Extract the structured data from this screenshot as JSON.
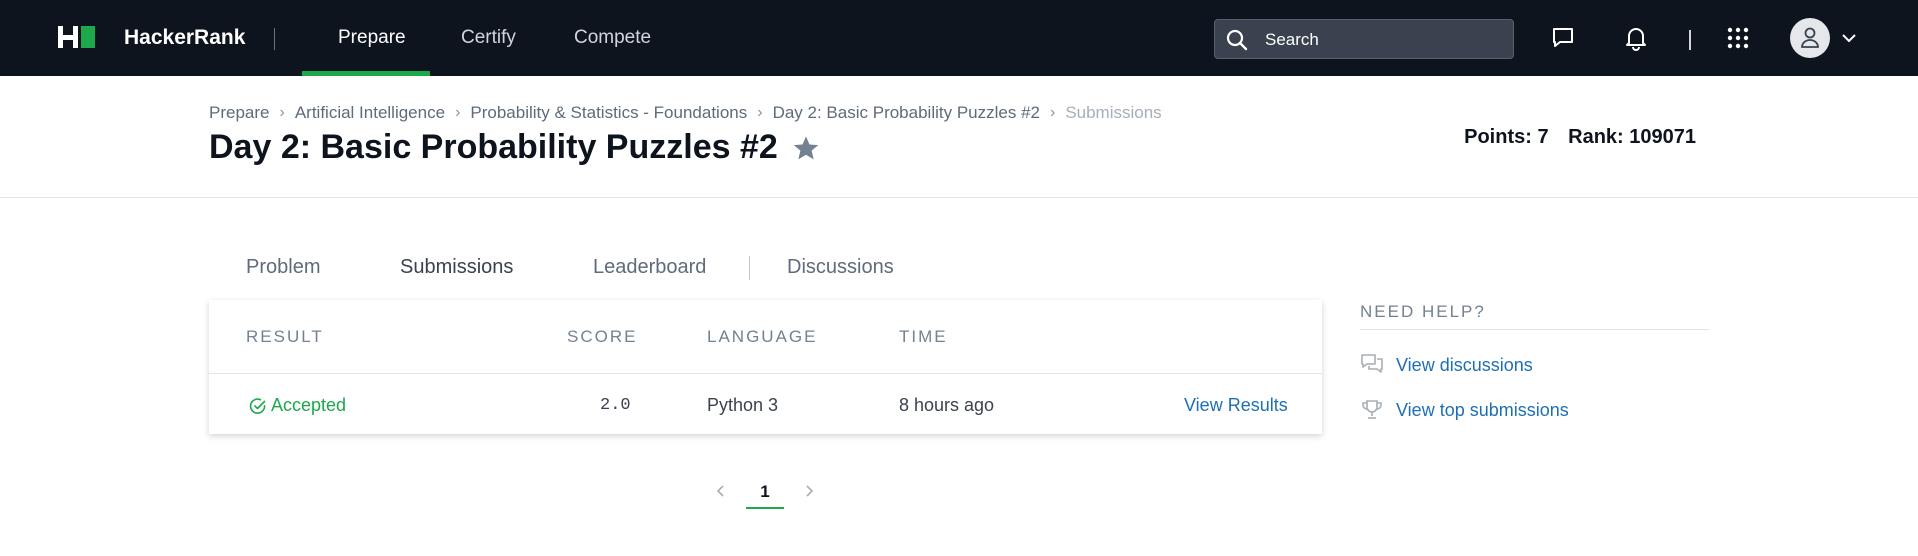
{
  "nav": {
    "brand": "HackerRank",
    "links": [
      "Prepare",
      "Certify",
      "Compete"
    ],
    "active": "Prepare",
    "search_placeholder": "Search",
    "icons": [
      "messages-icon",
      "notifications-icon",
      "apps-grid-icon",
      "avatar-icon",
      "chevron-down-icon"
    ],
    "accent_color": "#1ba94c"
  },
  "breadcrumb": {
    "items": [
      "Prepare",
      "Artificial Intelligence",
      "Probability & Statistics - Foundations",
      "Day 2: Basic Probability Puzzles #2"
    ],
    "current": "Submissions"
  },
  "page": {
    "title": "Day 2: Basic Probability Puzzles #2",
    "points_label": "Points: 7",
    "rank_label": "Rank: 109071"
  },
  "tabs": [
    "Problem",
    "Submissions",
    "Leaderboard",
    "Discussions"
  ],
  "active_tab": "Submissions",
  "table": {
    "headers": [
      "RESULT",
      "SCORE",
      "LANGUAGE",
      "TIME"
    ],
    "rows": [
      {
        "result": "Accepted",
        "score": "2.0",
        "language": "Python 3",
        "time": "8 hours ago",
        "action": "View Results"
      }
    ]
  },
  "pagination": {
    "current": "1"
  },
  "help": {
    "title": "NEED HELP?",
    "links": [
      "View discussions",
      "View top submissions"
    ]
  }
}
